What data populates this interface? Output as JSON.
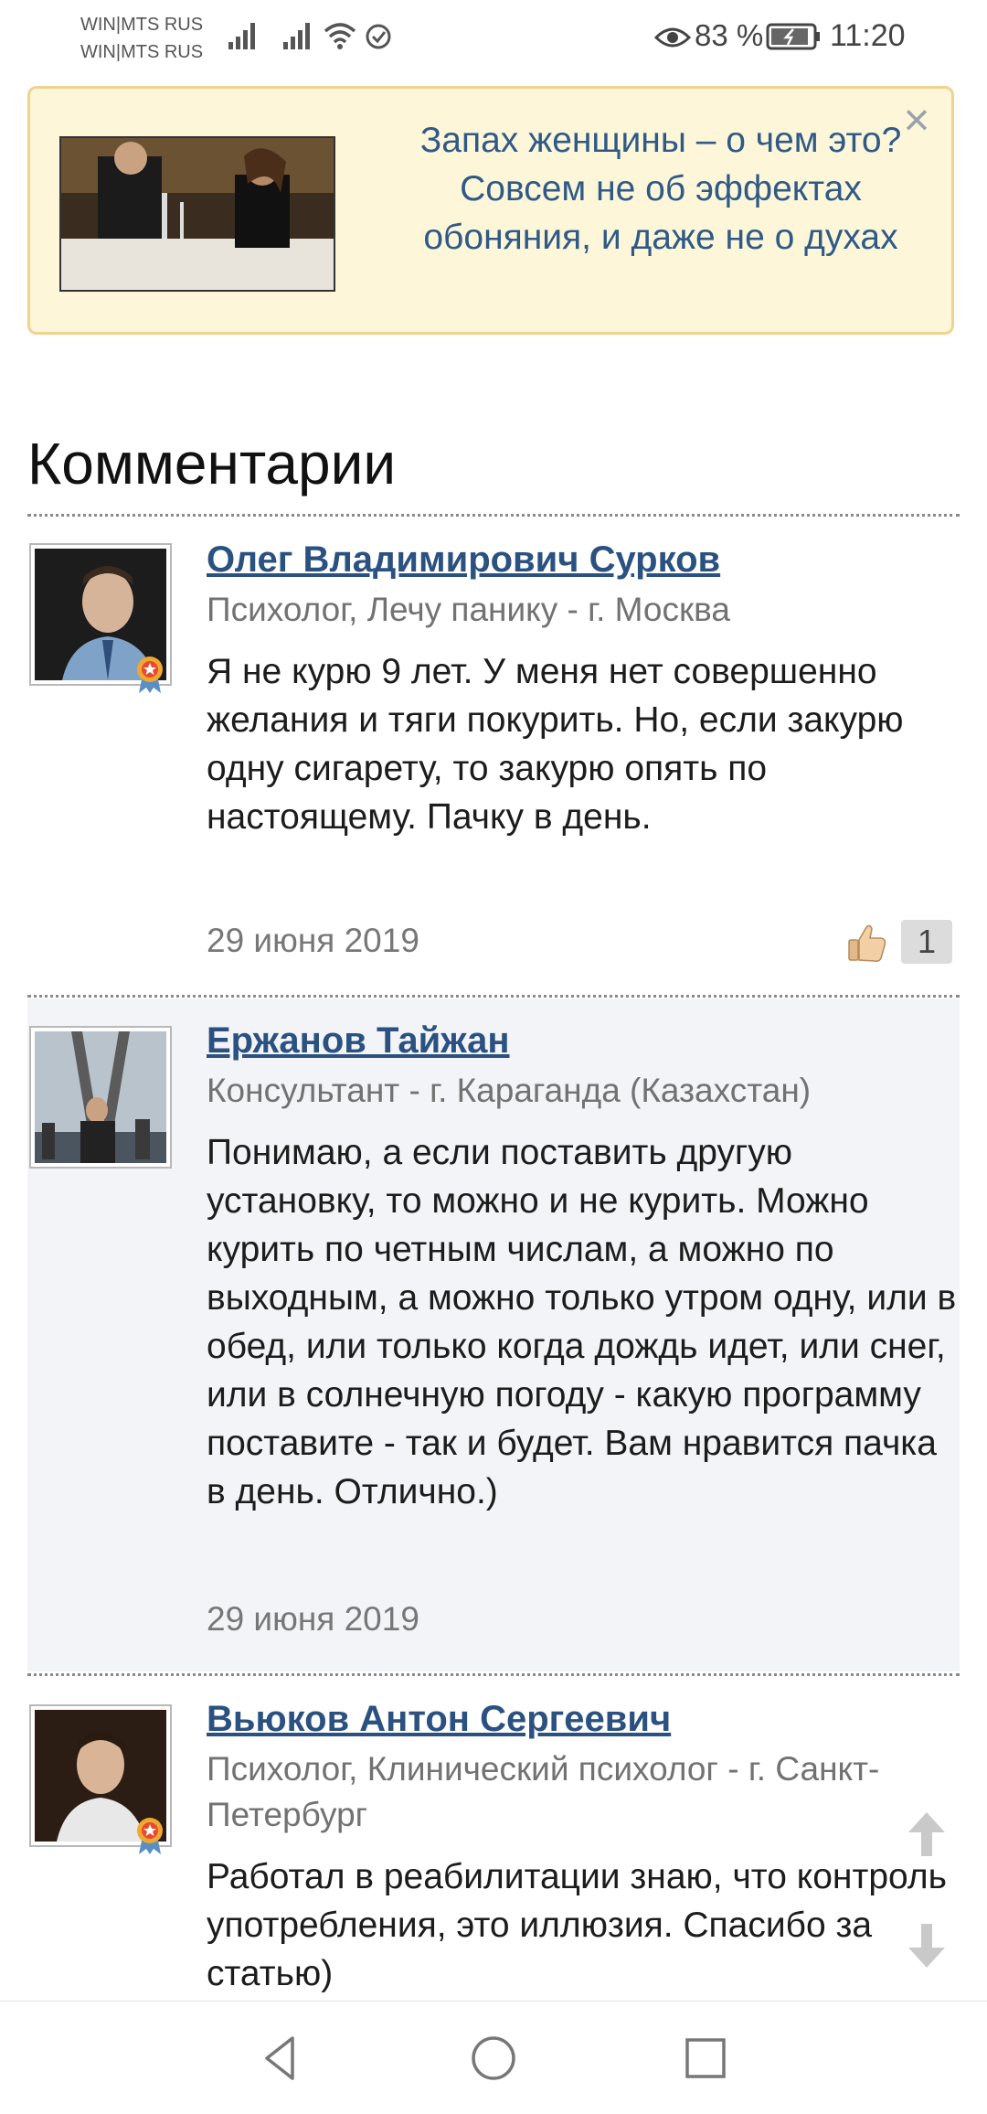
{
  "status_bar": {
    "carrier_1": "WIN|MTS RUS",
    "carrier_2": "WIN|MTS RUS",
    "battery": "83 %",
    "time": "11:20"
  },
  "promo": {
    "text": "Запах женщины – о чем это? Совсем не об эффектах обоняния, и даже не о духах",
    "close_label": "×"
  },
  "comments_title": "Комментарии",
  "comments": [
    {
      "author": "Олег Владимирович Сурков",
      "role": "Психолог, Лечу панику - г. Москва",
      "text": "Я не курю 9 лет. У меня нет совершенно желания и тяги покурить. Но, если закурю одну сигарету, то закурю опять по настоящему. Пачку в день.",
      "date": "29 июня 2019",
      "likes": "1"
    },
    {
      "author": "Ержанов Тайжан",
      "role": "Консультант - г. Караганда (Казахстан)",
      "text": "Понимаю, а если поставить другую установку, то можно и не курить. Можно курить по четным числам, а можно по выходным, а можно только утром одну, или в обед, или только когда дождь идет, или снег, или в солнечную погоду - какую программу поставите - так и будет. Вам нравится пачка в день. Отлично.)",
      "date": "29 июня 2019"
    },
    {
      "author": "Вьюков Антон Сергеевич",
      "role": "Психолог, Клинический психолог - г. Санкт-Петербург",
      "text": "Работал в реабилитации знаю, что контроль употребления, это иллюзия. Спасибо за статью)"
    }
  ],
  "colors": {
    "link": "#2b5180",
    "promo_bg": "#fdf6d9",
    "promo_border": "#f0d38e",
    "promo_text": "#2f5a87",
    "highlight_bg": "#f2f4f8"
  },
  "icons": [
    "signal-icon",
    "wifi-icon",
    "sync-check-icon",
    "eye-icon",
    "battery-icon",
    "award-badge-icon",
    "thumbs-up-icon",
    "arrow-up-icon",
    "arrow-down-icon",
    "nav-back-icon",
    "nav-home-icon",
    "nav-recent-icon"
  ]
}
